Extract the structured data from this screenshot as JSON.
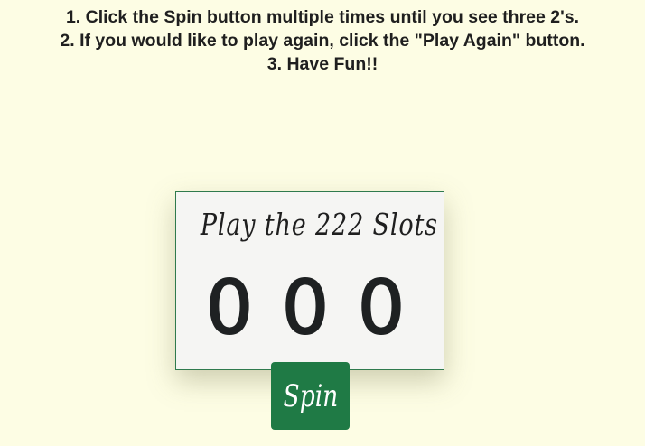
{
  "instructions": {
    "line1": "1. Click the Spin button multiple times until you see three 2's.",
    "line2": "2. If you would like to play again, click the \"Play Again\" button.",
    "line3": "3. Have Fun!!"
  },
  "slot_machine": {
    "title": "Play the 222 Slots",
    "reels": [
      "0",
      "0",
      "0"
    ]
  },
  "spin_button": {
    "label": "Spin"
  },
  "colors": {
    "background": "#fdfde4",
    "card_background": "#f5f5f3",
    "card_border": "#2f7a4d",
    "button_background": "#1f7a45",
    "button_text": "#ffffff",
    "text": "#1f1f1f"
  }
}
